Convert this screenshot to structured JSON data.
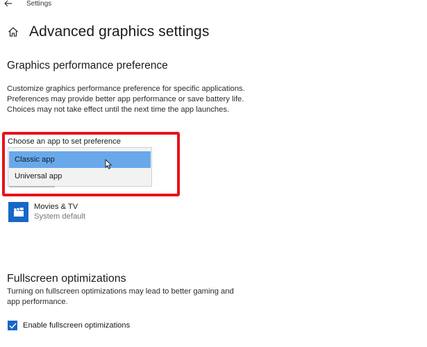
{
  "window": {
    "title": "Settings"
  },
  "header": {
    "title": "Advanced graphics settings"
  },
  "graphics": {
    "section_title": "Graphics performance preference",
    "description": "Customize graphics performance preference for specific applications. Preferences may provide better app performance or save battery life. Choices may not take effect until the next time the app launches.",
    "choose_label": "Choose an app to set preference",
    "dropdown_options": [
      "Classic app",
      "Universal app"
    ],
    "highlighted_option": "Classic app"
  },
  "apps": [
    {
      "name": "Movies & TV",
      "preference": "System default",
      "icon": "movies-tv-icon"
    }
  ],
  "fullscreen": {
    "section_title": "Fullscreen optimizations",
    "description": "Turning on fullscreen optimizations may lead to better gaming and app performance.",
    "checkbox_label": "Enable fullscreen optimizations",
    "checkbox_checked": true
  },
  "colors": {
    "accent": "#1667c7",
    "highlight_border": "#e8121c",
    "selected_option": "#69a9ea"
  },
  "icons": {
    "back": "back-arrow-icon",
    "home": "home-icon",
    "cursor": "mouse-cursor-icon",
    "checkbox": "checkmark-icon"
  }
}
